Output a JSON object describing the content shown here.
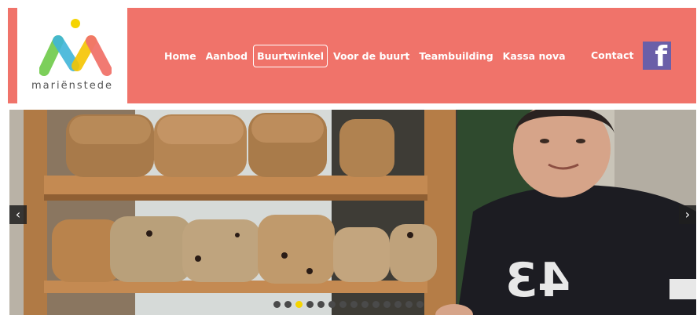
{
  "logo": {
    "text": "mariënstede"
  },
  "nav": {
    "items": [
      {
        "label": "Home",
        "active": false
      },
      {
        "label": "Aanbod",
        "active": false
      },
      {
        "label": "Buurtwinkel",
        "active": true
      },
      {
        "label": "Voor de buurt",
        "active": false
      },
      {
        "label": "Teambuilding",
        "active": false
      },
      {
        "label": "Kassa nova",
        "active": false
      }
    ],
    "contact": "Contact",
    "facebook_icon": "facebook-icon"
  },
  "slider": {
    "prev_icon": "chevron-left-icon",
    "next_icon": "chevron-right-icon",
    "shirt_text": "43",
    "dots_count": 14,
    "active_dot": 2
  },
  "colors": {
    "header": "#f0736a",
    "facebook": "#6a5fa8",
    "active_dot": "#f5d400"
  }
}
